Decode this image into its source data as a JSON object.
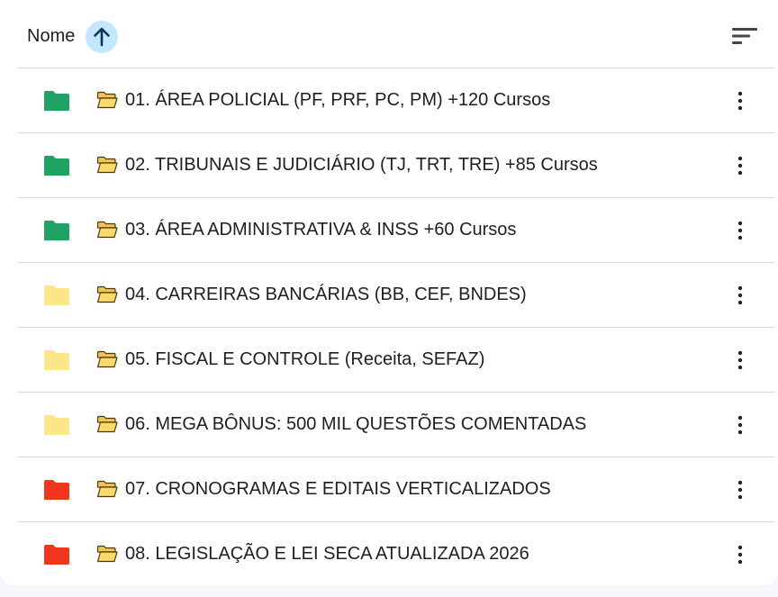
{
  "header": {
    "sort_label": "Nome",
    "sort_direction_icon": "arrow-up-icon",
    "view_icon": "sort-lines-icon",
    "accent": "#c2e7ff",
    "arrow_color": "#0b3559"
  },
  "folders": [
    {
      "label": "01. ÁREA POLICIAL (PF, PRF, PC, PM) +120 Cursos",
      "color": "#1ea362",
      "icon": "folder-icon",
      "emoji_icon": "open-folder-emoji-icon"
    },
    {
      "label": "02. TRIBUNAIS E JUDICIÁRIO (TJ, TRT, TRE) +85 Cursos",
      "color": "#1ea362",
      "icon": "folder-icon",
      "emoji_icon": "open-folder-emoji-icon"
    },
    {
      "label": "03. ÁREA ADMINISTRATIVA & INSS +60 Cursos",
      "color": "#1ea362",
      "icon": "folder-icon",
      "emoji_icon": "open-folder-emoji-icon"
    },
    {
      "label": "04. CARREIRAS BANCÁRIAS (BB, CEF, BNDES)",
      "color": "#fbe68a",
      "icon": "folder-icon",
      "emoji_icon": "open-folder-emoji-icon"
    },
    {
      "label": "05. FISCAL E CONTROLE (Receita, SEFAZ)",
      "color": "#fbe68a",
      "icon": "folder-icon",
      "emoji_icon": "open-folder-emoji-icon"
    },
    {
      "label": "06. MEGA BÔNUS: 500 MIL QUESTÕES COMENTADAS",
      "color": "#fbe68a",
      "icon": "folder-icon",
      "emoji_icon": "open-folder-emoji-icon"
    },
    {
      "label": "07. CRONOGRAMAS E EDITAIS VERTICALIZADOS",
      "color": "#f2351f",
      "icon": "folder-icon",
      "emoji_icon": "open-folder-emoji-icon"
    },
    {
      "label": "08. LEGISLAÇÃO E LEI SECA ATUALIZADA 2026",
      "color": "#f2351f",
      "icon": "folder-icon",
      "emoji_icon": "open-folder-emoji-icon"
    }
  ],
  "row_action_icon": "more-vert-icon"
}
